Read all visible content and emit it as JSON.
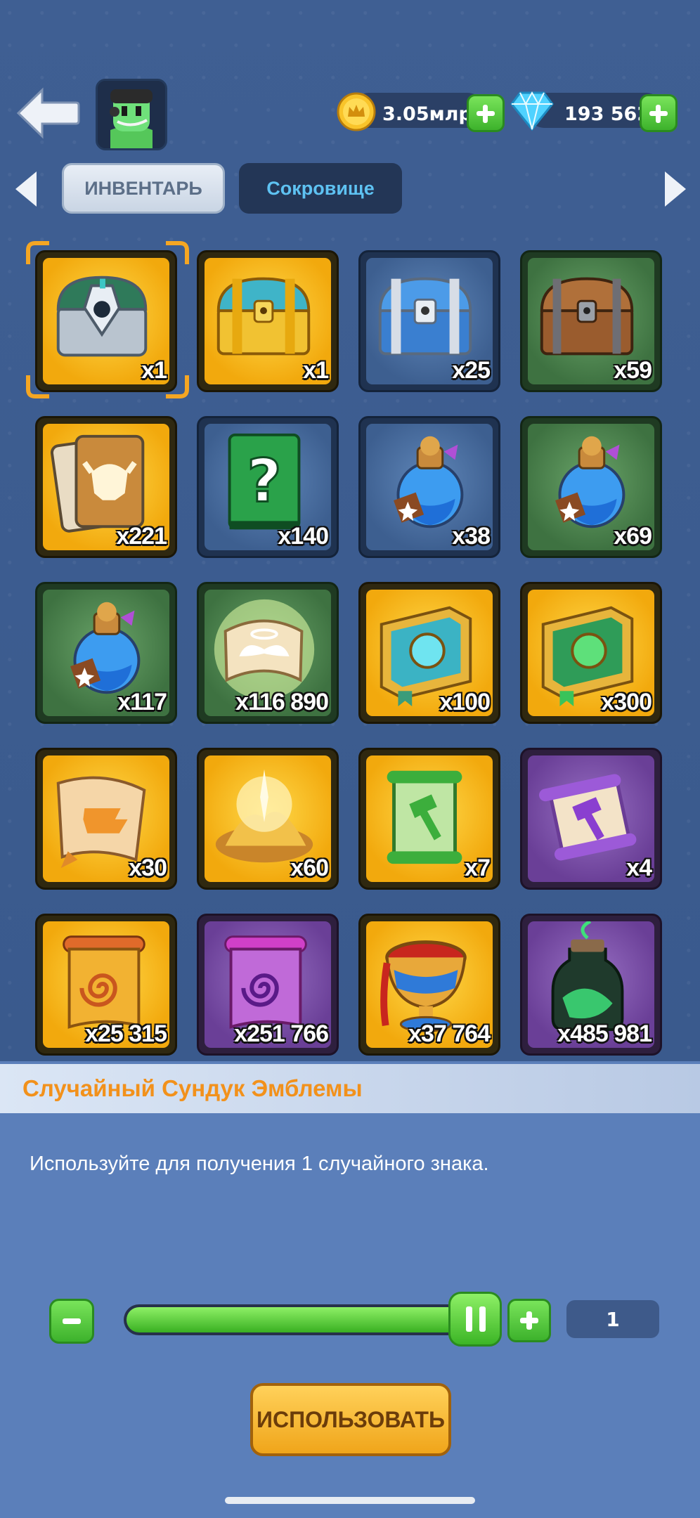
{
  "header": {
    "back_icon": "back-arrow-icon",
    "avatar_icon": "player-avatar-icon",
    "gold": {
      "icon": "crown-coin-icon",
      "value": "3.05млрд"
    },
    "gems": {
      "icon": "diamond-icon",
      "value": "193 562"
    }
  },
  "tabs": [
    {
      "label": "ИНВЕНТАРЬ",
      "active": true
    },
    {
      "label": "Сокровище",
      "active": false
    }
  ],
  "items": [
    {
      "name": "emblem-chest",
      "icon": "silver-shield-chest-icon",
      "count": "x1",
      "rarity": "gold"
    },
    {
      "name": "gold-chest",
      "icon": "gold-chest-icon",
      "count": "x1",
      "rarity": "gold"
    },
    {
      "name": "silver-chest",
      "icon": "silver-chest-icon",
      "count": "x25",
      "rarity": "blue"
    },
    {
      "name": "wooden-chest",
      "icon": "wooden-chest-icon",
      "count": "x59",
      "rarity": "green"
    },
    {
      "name": "hero-card",
      "icon": "helmet-card-icon",
      "count": "x221",
      "rarity": "gold"
    },
    {
      "name": "mystery-book",
      "icon": "question-book-icon",
      "count": "x140",
      "rarity": "blue"
    },
    {
      "name": "blue-potion",
      "icon": "blue-potion-icon",
      "count": "x38",
      "rarity": "blue"
    },
    {
      "name": "blue-potion",
      "icon": "blue-potion-icon",
      "count": "x69",
      "rarity": "green"
    },
    {
      "name": "blue-potion",
      "icon": "blue-potion-icon",
      "count": "x117",
      "rarity": "green"
    },
    {
      "name": "angel-scroll",
      "icon": "winged-scroll-icon",
      "count": "x116 890",
      "rarity": "green"
    },
    {
      "name": "blue-tome",
      "icon": "blue-gem-book-icon",
      "count": "x100",
      "rarity": "gold"
    },
    {
      "name": "green-tome",
      "icon": "green-gem-book-icon",
      "count": "x300",
      "rarity": "gold"
    },
    {
      "name": "forge-scroll",
      "icon": "anvil-scroll-icon",
      "count": "x30",
      "rarity": "gold"
    },
    {
      "name": "gold-dust",
      "icon": "gold-dust-icon",
      "count": "x60",
      "rarity": "gold"
    },
    {
      "name": "hammer-scroll",
      "icon": "green-hammer-scroll-icon",
      "count": "x7",
      "rarity": "gold"
    },
    {
      "name": "hammer-scroll",
      "icon": "purple-hammer-scroll-icon",
      "count": "x4",
      "rarity": "purple"
    },
    {
      "name": "spiral-scroll",
      "icon": "orange-spiral-scroll-icon",
      "count": "x25 315",
      "rarity": "gold"
    },
    {
      "name": "spiral-scroll",
      "icon": "purple-spiral-scroll-icon",
      "count": "x251 766",
      "rarity": "purple"
    },
    {
      "name": "ruby-goblet",
      "icon": "red-goblet-icon",
      "count": "x37 764",
      "rarity": "gold"
    },
    {
      "name": "essence-bottle",
      "icon": "green-bottle-icon",
      "count": "x485 981",
      "rarity": "purple"
    }
  ],
  "details": {
    "title": "Случайный Сундук Эмблемы",
    "description": "Используйте для получения 1 случайного знака.",
    "quantity": "1",
    "slider_fraction": 1.0,
    "use_label": "ИСПОЛЬЗОВАТЬ"
  }
}
